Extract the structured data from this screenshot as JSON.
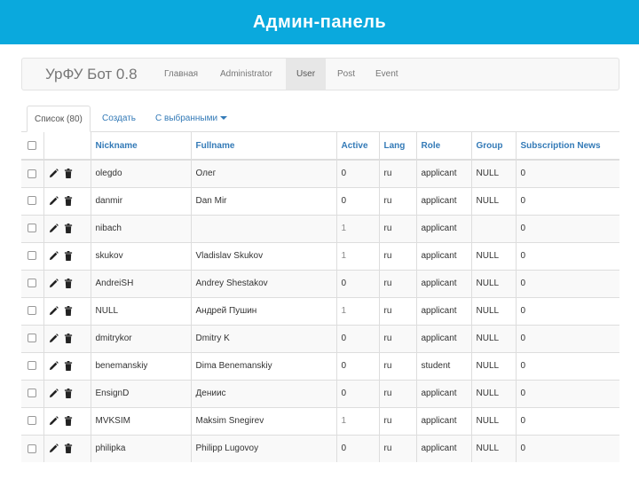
{
  "slide": {
    "title": "Админ-панель"
  },
  "navbar": {
    "brand": "УрФУ Бот 0.8",
    "items": [
      {
        "label": "Главная",
        "active": false
      },
      {
        "label": "Administrator",
        "active": false
      },
      {
        "label": "User",
        "active": true
      },
      {
        "label": "Post",
        "active": false
      },
      {
        "label": "Event",
        "active": false
      }
    ]
  },
  "tabs": [
    {
      "label": "Список (80)",
      "active": true
    },
    {
      "label": "Создать",
      "active": false
    },
    {
      "label": "С выбранными",
      "active": false,
      "dropdown": true
    }
  ],
  "table": {
    "columns": [
      "Nickname",
      "Fullname",
      "Active",
      "Lang",
      "Role",
      "Group",
      "Subscription News"
    ],
    "rows": [
      [
        "olegdo",
        "Олег",
        "0",
        "ru",
        "applicant",
        "NULL",
        "0"
      ],
      [
        "danmir",
        "Dan Mir",
        "0",
        "ru",
        "applicant",
        "NULL",
        "0"
      ],
      [
        "nibach",
        "",
        "1",
        "ru",
        "applicant",
        "",
        "0"
      ],
      [
        "skukov",
        "Vladislav Skukov",
        "1",
        "ru",
        "applicant",
        "NULL",
        "0"
      ],
      [
        "AndreiSH",
        "Andrey Shestakov",
        "0",
        "ru",
        "applicant",
        "NULL",
        "0"
      ],
      [
        "NULL",
        "Андрей Пушин",
        "1",
        "ru",
        "applicant",
        "NULL",
        "0"
      ],
      [
        "dmitrykor",
        "Dmitry K",
        "0",
        "ru",
        "applicant",
        "NULL",
        "0"
      ],
      [
        "benemanskiy",
        "Dima Benemanskiy",
        "0",
        "ru",
        "student",
        "NULL",
        "0"
      ],
      [
        "EnsignD",
        "Дениис",
        "0",
        "ru",
        "applicant",
        "NULL",
        "0"
      ],
      [
        "MVKSIM",
        "Maksim Snegirev",
        "1",
        "ru",
        "applicant",
        "NULL",
        "0"
      ],
      [
        "philipka",
        "Philipp Lugovoy",
        "0",
        "ru",
        "applicant",
        "NULL",
        "0"
      ]
    ]
  }
}
